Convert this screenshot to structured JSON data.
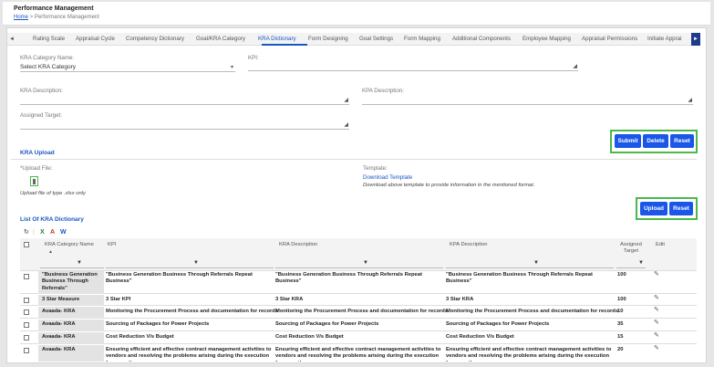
{
  "header": {
    "title": "Performance Management",
    "breadcrumb_home": "Home",
    "breadcrumb_sep": ">",
    "breadcrumb_current": "Performance Management"
  },
  "tabs": [
    {
      "label": "Rating Scale",
      "active": false
    },
    {
      "label": "Appraisal Cycle",
      "active": false
    },
    {
      "label": "Competency Dictionary",
      "active": false
    },
    {
      "label": "Goal/KRA Category",
      "active": false
    },
    {
      "label": "KRA Dictionary",
      "active": true
    },
    {
      "label": "Form Designing",
      "active": false
    },
    {
      "label": "Goal Settings",
      "active": false
    },
    {
      "label": "Form Mapping",
      "active": false
    },
    {
      "label": "Additional Components",
      "active": false
    },
    {
      "label": "Employee Mapping",
      "active": false
    },
    {
      "label": "Appraisal Permissions",
      "active": false
    },
    {
      "label": "Initiate Apprai",
      "active": false
    }
  ],
  "form": {
    "kra_category_label": "KRA Category Name:",
    "kra_category_value": "Select KRA Category",
    "kpi_label": "KPI:",
    "kra_desc_label": "KRA Description:",
    "kpa_desc_label": "KPA Description:",
    "assigned_target_label": "Assigned Target:",
    "submit": "Submit",
    "delete": "Delete",
    "reset": "Reset"
  },
  "upload": {
    "section_title": "KRA Upload",
    "upload_file_label": "*Upload File:",
    "file_type_note": "Upload file of type .xlsx only",
    "template_label": "Template:",
    "download_template": "Download Template",
    "template_note": "Download above template to provide information in the mentioned format.",
    "upload": "Upload",
    "reset": "Reset"
  },
  "list": {
    "title": "List Of KRA Dictionary",
    "columns": {
      "category": "KRA Category Name",
      "kpi": "KPI",
      "kra_desc": "KRA Description",
      "kpa_desc": "KPA Description",
      "target_1": "Assigned",
      "target_2": "Target",
      "edit": "Edit"
    },
    "rows": [
      {
        "category": "\"Business Generation Business Through Referrals\"",
        "kpi": "\"Business Generation Business Through Referrals Repeat Business\"",
        "kra": "\"Business Generation Business Through Referrals Repeat Business\"",
        "kpa": "\"Business Generation Business Through Referrals Repeat Business\"",
        "target": "100"
      },
      {
        "category": "3 Star Measure",
        "kpi": "3 Star KPI",
        "kra": "3 Star KRA",
        "kpa": "3 Star KRA",
        "target": "100"
      },
      {
        "category": "Avaada- KRA",
        "kpi": "Monitoring the Procurement Process and documentation for records",
        "kra": "Monitoring the Procurement Process and documentation for records",
        "kpa": "Monitoring the Procurement Process and documentation for records",
        "target": "10"
      },
      {
        "category": "Avaada- KRA",
        "kpi": "Sourcing of Packages for Power Projects",
        "kra": "Sourcing of Packages for Power Projects",
        "kpa": "Sourcing of Packages for Power Projects",
        "target": "35"
      },
      {
        "category": "Avaada- KRA",
        "kpi": "Cost Reduction V/s Budget",
        "kra": "Cost Reduction V/s Budget",
        "kpa": "Cost Reduction V/s Budget",
        "target": "15"
      },
      {
        "category": "Avaada- KRA",
        "kpi": "Ensuring efficient and effective contract management activities to vendors and resolving the problems arising during the execution for smooth",
        "kra": "Ensuring efficient and effective contract management activities to vendors and resolving the problems arising during the execution for smooth",
        "kpa": "Ensuring efficient and effective contract management activities to vendors and resolving the problems arising during the execution for smooth",
        "target": "20"
      }
    ]
  },
  "colors": {
    "accent": "#1a56c4",
    "button": "#1a56e8",
    "highlight": "#4bb84b"
  }
}
